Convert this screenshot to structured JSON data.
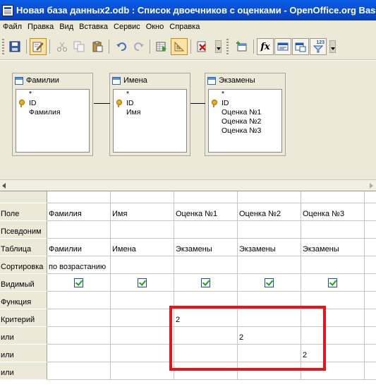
{
  "window": {
    "title": "Новая база данных2.odb : Список двоечников с оценками - OpenOffice.org Base: Query Design"
  },
  "menu": [
    "Файл",
    "Правка",
    "Вид",
    "Вставка",
    "Сервис",
    "Окно",
    "Справка"
  ],
  "toolbar": {
    "icons": [
      "save-icon",
      "edit-icon",
      "cut-icon",
      "copy-icon",
      "paste-icon",
      "undo-icon",
      "redo-icon",
      "run-query-icon",
      "design-view-icon",
      "clear-query-icon",
      "add-table-icon",
      "functions-icon",
      "table-name-icon",
      "alias-icon",
      "distinct-values-icon"
    ],
    "fx_label": "fx",
    "distinct_label": "123"
  },
  "tables": [
    {
      "title": "Фамилии",
      "fields": [
        "*",
        "ID",
        "Фамилия"
      ],
      "key_index": 1
    },
    {
      "title": "Имена",
      "fields": [
        "*",
        "ID",
        "Имя"
      ],
      "key_index": 1
    },
    {
      "title": "Экзамены",
      "fields": [
        "*",
        "ID",
        "Оценка №1",
        "Оценка №2",
        "Оценка №3"
      ],
      "key_index": 1
    }
  ],
  "grid": {
    "rows": [
      {
        "label": "Поле",
        "cells": [
          "Фамилия",
          "Имя",
          "Оценка №1",
          "Оценка №2",
          "Оценка №3"
        ]
      },
      {
        "label": "Псевдоним",
        "cells": [
          "",
          "",
          "",
          "",
          ""
        ]
      },
      {
        "label": "Таблица",
        "cells": [
          "Фамилии",
          "Имена",
          "Экзамены",
          "Экзамены",
          "Экзамены"
        ]
      },
      {
        "label": "Сортировка",
        "cells": [
          "по возрастанию",
          "",
          "",
          "",
          ""
        ]
      },
      {
        "label": "Видимый",
        "checks": [
          true,
          true,
          true,
          true,
          true
        ]
      },
      {
        "label": "Функция",
        "cells": [
          "",
          "",
          "",
          "",
          ""
        ]
      },
      {
        "label": "Критерий",
        "cells": [
          "",
          "",
          "2",
          "",
          ""
        ]
      },
      {
        "label": "или",
        "cells": [
          "",
          "",
          "",
          "2",
          ""
        ]
      },
      {
        "label": "или",
        "cells": [
          "",
          "",
          "",
          "",
          "2"
        ]
      },
      {
        "label": "или",
        "cells": [
          "",
          "",
          "",
          "",
          ""
        ]
      }
    ]
  },
  "colors": {
    "titlebar": "#0a4fd6",
    "chrome": "#ece9d8",
    "highlight": "#e8141c",
    "check": "#21a121"
  }
}
